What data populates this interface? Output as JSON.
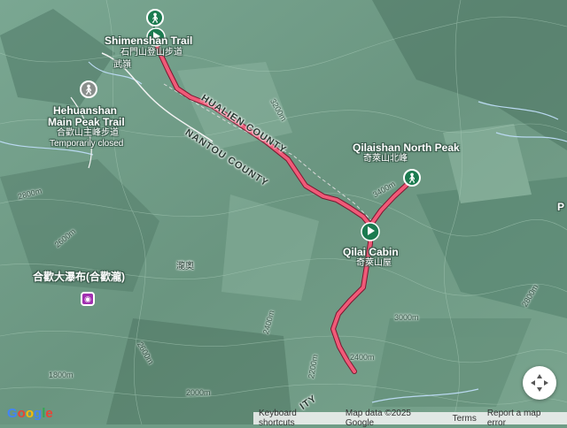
{
  "labels": {
    "shimen_title": "Shimenshan Trail",
    "shimen_sub": "石門山登山步道",
    "wuling": "武嶺",
    "hehuan_title1": "Hehuanshan",
    "hehuan_title2": "Main Peak Trail",
    "hehuan_sub": "合歡山主峰步道",
    "hehuan_status": "Temporarily closed",
    "qilaishan_title": "Qilaishan North Peak",
    "qilaishan_sub": "奇萊山北峰",
    "cabin_title": "Qilai Cabin",
    "cabin_sub": "奇萊山屋",
    "waterfall": "合歡大瀑布(合歡瀧)",
    "village": "瀧奧",
    "edge_letter": "P"
  },
  "roads": {
    "hualien": "HUALIEN COUNTY",
    "nantou": "NANTOU COUNTY",
    "bottom": "ITY"
  },
  "contours": [
    "3400m",
    "3200m",
    "3000m",
    "2800m",
    "2600m",
    "2400m",
    "2200m",
    "1800m",
    "2800m",
    "2600m",
    "2400m",
    "2000m"
  ],
  "icons": {
    "shimen": "hiking-icon",
    "hehuan": "hiking-icon",
    "qilaishan": "hiking-icon",
    "waterfall": "camera-icon",
    "start": "start-flag-icon",
    "cabin": "flag-icon",
    "compass": "compass-icon"
  },
  "footer": {
    "keyboard": "Keyboard shortcuts",
    "mapdata": "Map data ©2025 Google",
    "terms": "Terms",
    "report": "Report a map error"
  },
  "brand": "Google",
  "colors": {
    "route": "#f05a78",
    "route_outline": "#7a1830",
    "terrain": "#6f9c86",
    "pin_green": "#1c7b50"
  }
}
